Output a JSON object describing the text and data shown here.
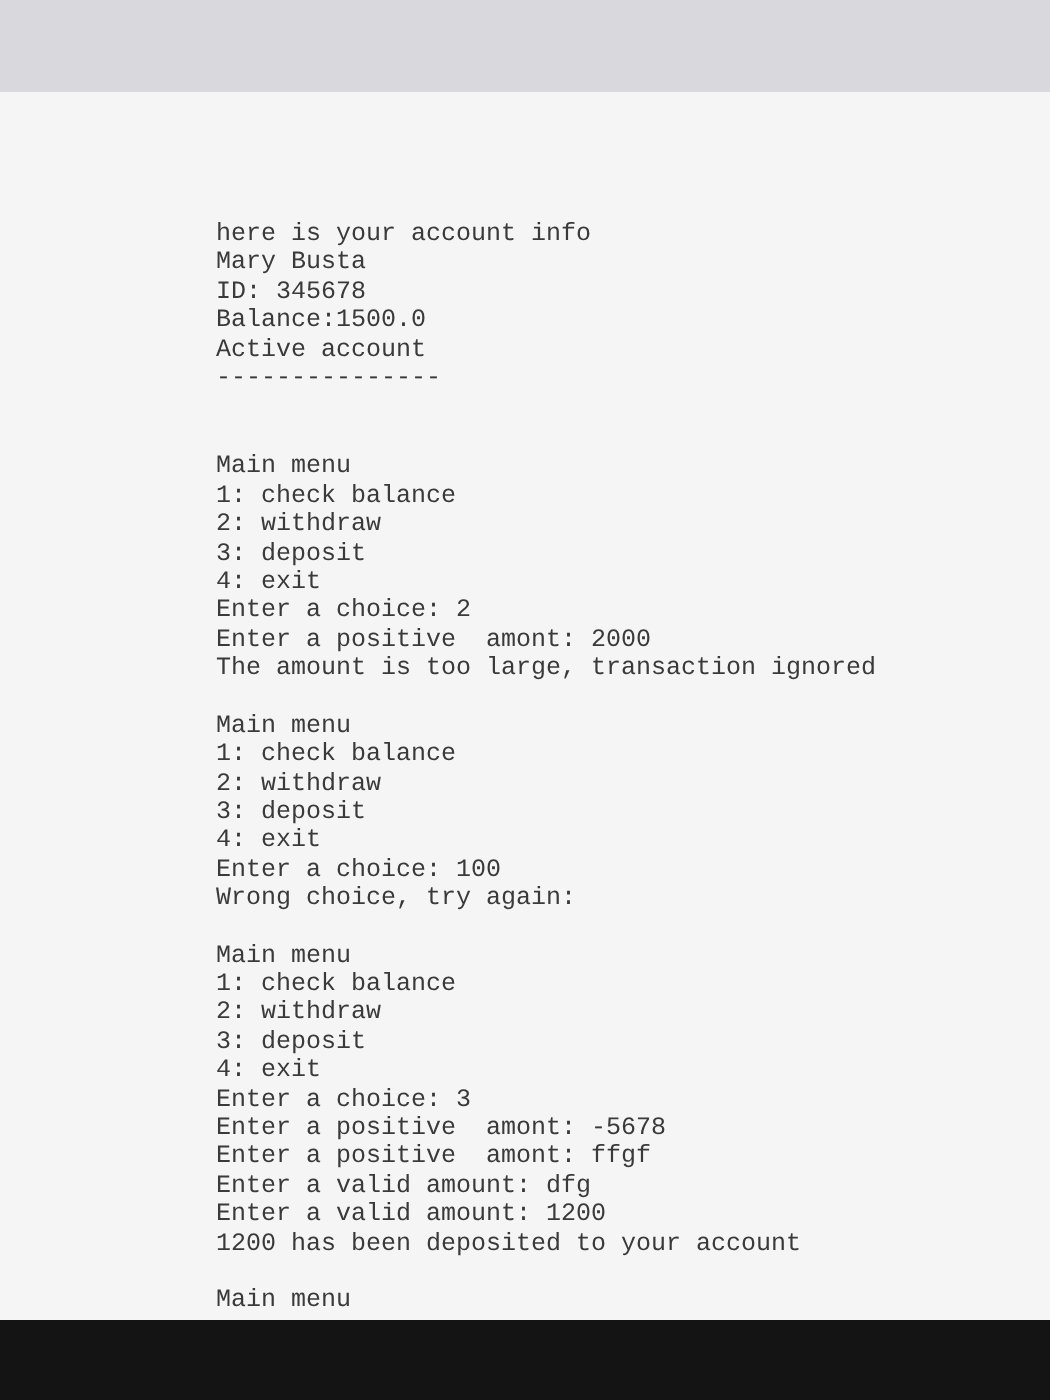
{
  "console": {
    "blocks": [
      {
        "lines": [
          "here is your account info",
          "Mary Busta",
          "ID: 345678",
          "Balance:1500.0",
          "Active account",
          "---------------"
        ]
      },
      {
        "lines": [
          "Main menu",
          "1: check balance",
          "2: withdraw",
          "3: deposit",
          "4: exit",
          "Enter a choice: 2",
          "Enter a positive  amont: 2000",
          "The amount is too large, transaction ignored"
        ]
      },
      {
        "lines": [
          "Main menu",
          "1: check balance",
          "2: withdraw",
          "3: deposit",
          "4: exit",
          "Enter a choice: 100",
          "Wrong choice, try again:"
        ]
      },
      {
        "lines": [
          "Main menu",
          "1: check balance",
          "2: withdraw",
          "3: deposit",
          "4: exit",
          "Enter a choice: 3",
          "Enter a positive  amont: -5678",
          "Enter a positive  amont: ffgf",
          "Enter a valid amount: dfg",
          "Enter a valid amount: 1200",
          "1200 has been deposited to your account"
        ]
      },
      {
        "lines": [
          "Main menu"
        ]
      }
    ]
  }
}
